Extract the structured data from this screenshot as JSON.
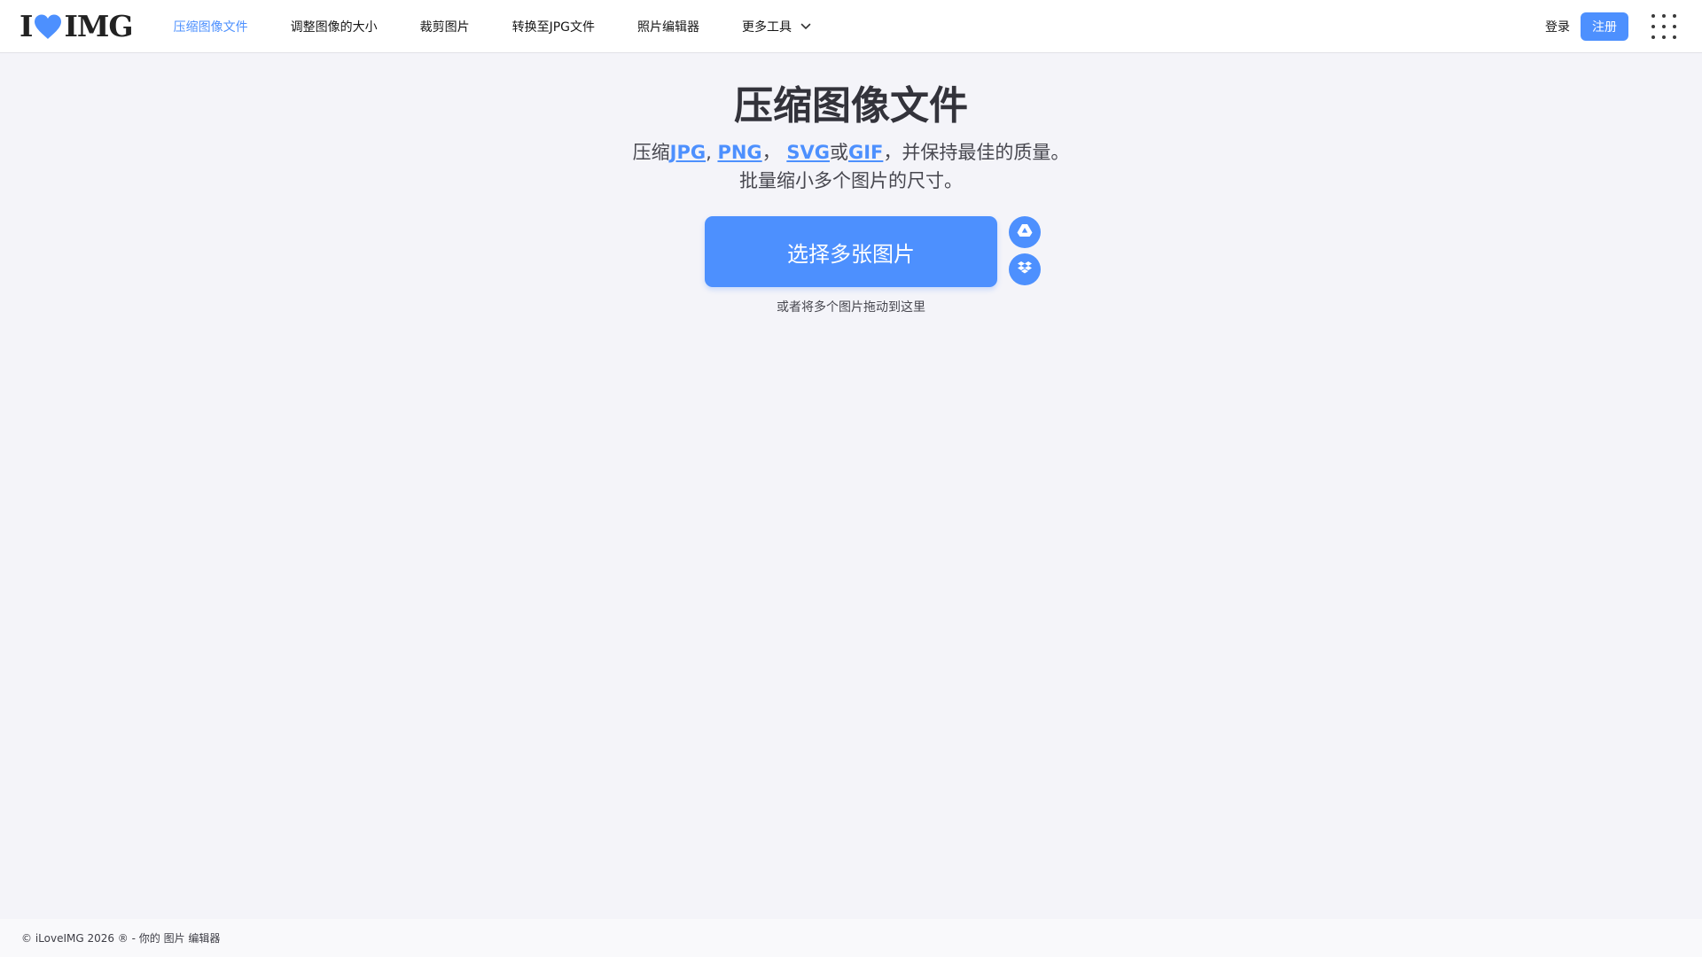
{
  "brand": {
    "logo_left": "I",
    "logo_right": "IMG",
    "accent": "#4d90fe"
  },
  "nav": {
    "items": [
      {
        "label": "压缩图像文件",
        "active": true
      },
      {
        "label": "调整图像的大小",
        "active": false
      },
      {
        "label": "裁剪图片",
        "active": false
      },
      {
        "label": "转换至JPG文件",
        "active": false
      },
      {
        "label": "照片编辑器",
        "active": false
      },
      {
        "label": "更多工具",
        "active": false,
        "dropdown": true
      }
    ]
  },
  "account": {
    "login_label": "登录",
    "signup_label": "注册",
    "apps_icon": "grid-icon"
  },
  "main": {
    "title": "压缩图像文件",
    "subtitle": {
      "prefix": "压缩",
      "fmt1": "JPG",
      "sep1": ",",
      "fmt2": "PNG",
      "sep2": "，",
      "fmt3": "SVG",
      "sep3": "或",
      "fmt4": "GIF",
      "suffix": "，并保持最佳的质量。",
      "line2": "批量缩小多个图片的尺寸。"
    },
    "select_button": "选择多张图片",
    "cloud_icons": [
      "google-drive-icon",
      "dropbox-icon"
    ],
    "drop_hint": "或者将多个图片拖动到这里"
  },
  "footer": {
    "text": "© iLoveIMG 2026 ® - 你的 图片 编辑器"
  }
}
